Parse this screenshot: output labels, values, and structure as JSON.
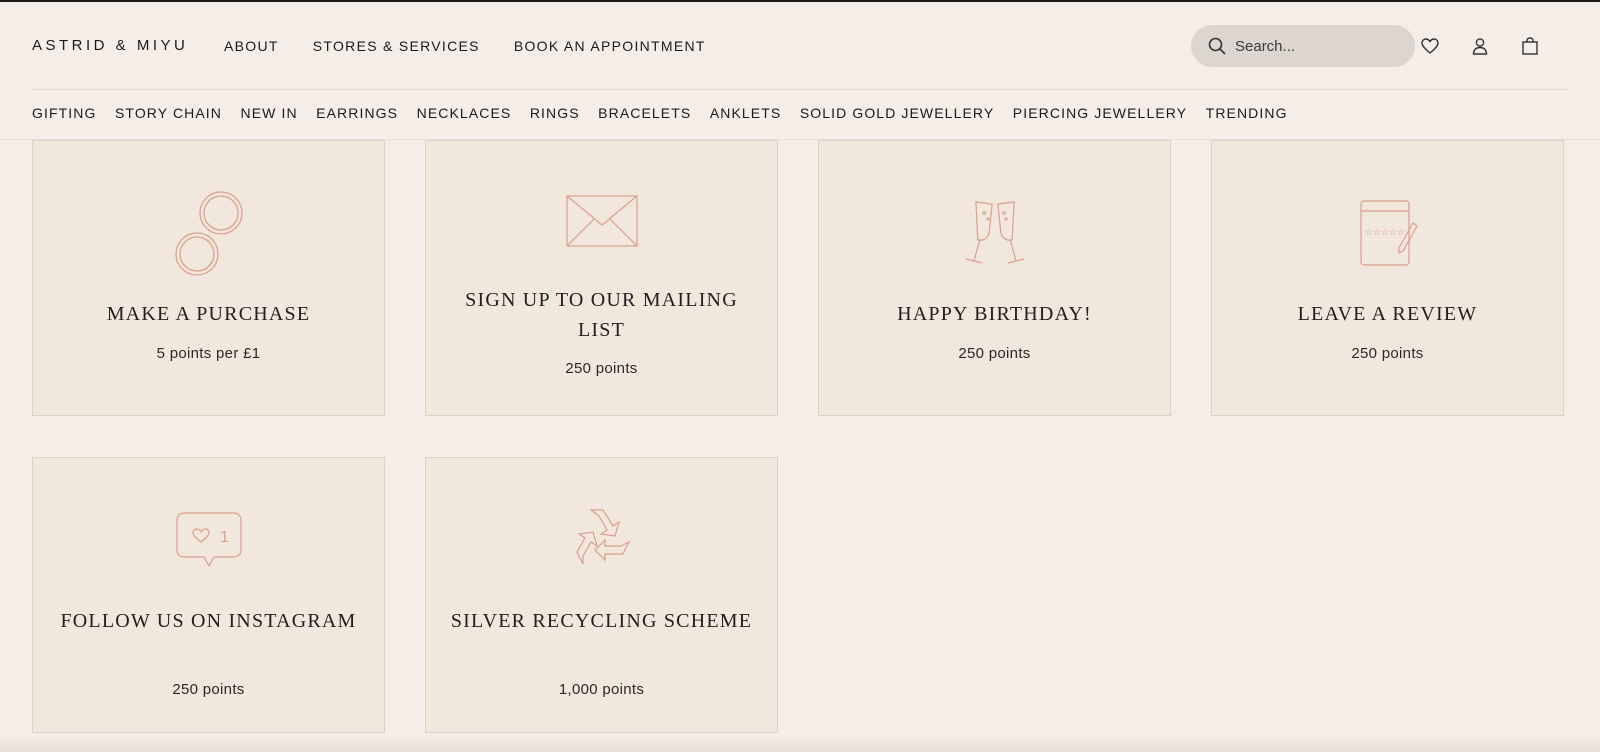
{
  "brand": {
    "logo": "ASTRID & MIYU"
  },
  "primary_nav": [
    "ABOUT",
    "STORES & SERVICES",
    "BOOK AN APPOINTMENT"
  ],
  "search": {
    "placeholder": "Search..."
  },
  "header_icons": [
    "heart-icon",
    "user-icon",
    "bag-icon"
  ],
  "category_nav": [
    "GIFTING",
    "STORY CHAIN",
    "NEW IN",
    "EARRINGS",
    "NECKLACES",
    "RINGS",
    "BRACELETS",
    "ANKLETS",
    "SOLID GOLD JEWELLERY",
    "PIERCING JEWELLERY",
    "TRENDING"
  ],
  "colors": {
    "background": "#f5ede7",
    "card": "#f1e7dc",
    "card_border": "#ddd2c7",
    "icon_stroke": "#d9a090",
    "search_bg": "#ddd5cf"
  },
  "cards": [
    {
      "icon": "hoop-earrings-icon",
      "title": "MAKE A PURCHASE",
      "points": "5 points per £1"
    },
    {
      "icon": "envelope-icon",
      "title": "SIGN UP TO OUR MAILING LIST",
      "points": "250 points"
    },
    {
      "icon": "champagne-icon",
      "title": "HAPPY BIRTHDAY!",
      "points": "250 points"
    },
    {
      "icon": "review-notepad-icon",
      "title": "LEAVE A REVIEW",
      "points": "250 points"
    },
    {
      "icon": "instagram-like-icon",
      "title": "FOLLOW US ON INSTAGRAM",
      "points": "250 points",
      "like_count": "1"
    },
    {
      "icon": "recycle-icon",
      "title": "SILVER RECYCLING SCHEME",
      "points": "1,000 points"
    }
  ]
}
